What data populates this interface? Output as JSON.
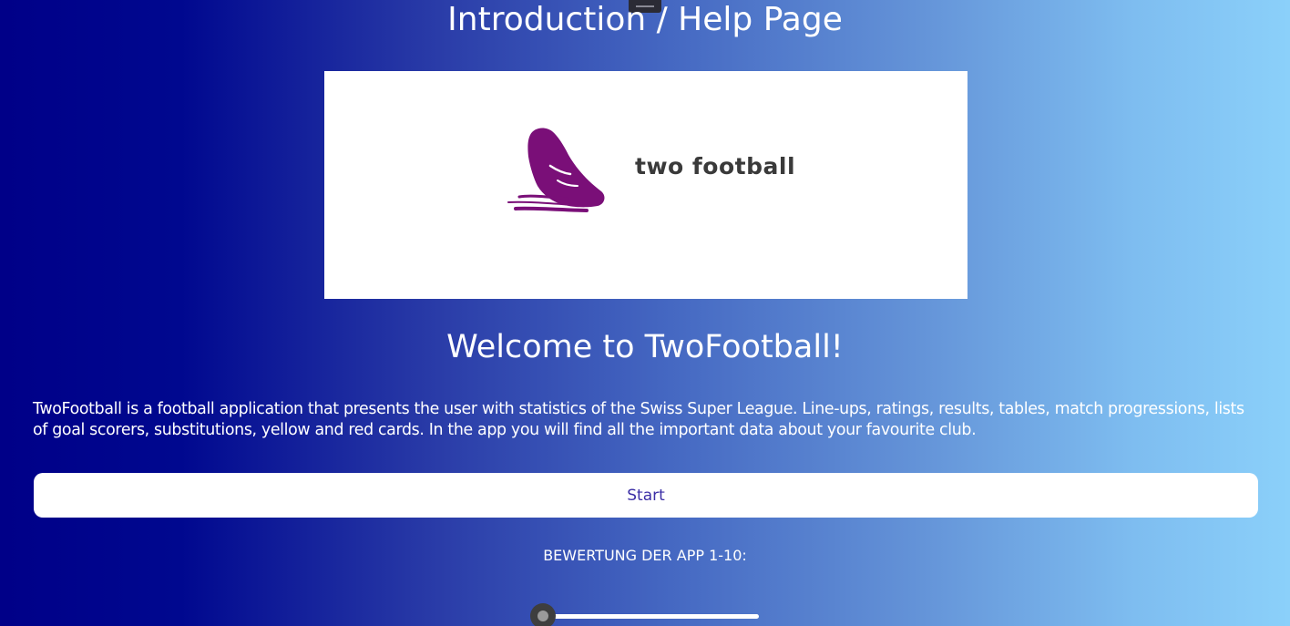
{
  "page": {
    "title": "Introduction / Help Page"
  },
  "banner": {
    "brand_text": "two football",
    "logo_icon": "football-boot-icon",
    "logo_color": "#7a0f78"
  },
  "welcome": {
    "heading": "Welcome to TwoFootball!",
    "description": "TwoFootball is a football application that presents the user with statistics of the Swiss Super League. Line-ups, ratings, results, tables, match progressions, lists of goal scorers, substitutions, yellow and red cards. In the app you will find all the important data about your favourite club."
  },
  "actions": {
    "start_label": "Start"
  },
  "rating": {
    "label": "BEWERTUNG DER APP 1-10:",
    "min": 1,
    "max": 10,
    "value": 1
  },
  "colors": {
    "gradient_start": "#000088",
    "gradient_end": "#8bd0fa",
    "button_text": "#3c2fa6"
  }
}
